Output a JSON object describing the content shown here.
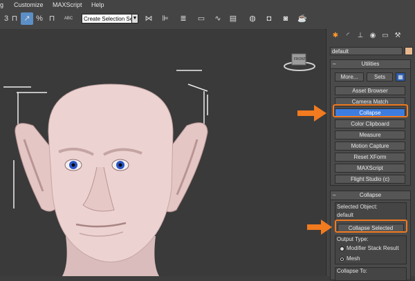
{
  "menubar": {
    "items": [
      "g",
      "Customize",
      "MAXScript",
      "Help"
    ]
  },
  "toolbar": {
    "selection_set": "Create Selection Se",
    "numbers": [
      "3",
      "%"
    ],
    "text_abc": "ABC"
  },
  "viewport": {
    "viewcube_label": "FRONT"
  },
  "command_panel": {
    "object_name": "default",
    "accent_color": "#e8b88f",
    "utilities": {
      "title": "Utilities",
      "more_label": "More...",
      "sets_label": "Sets",
      "buttons": [
        "Asset Browser",
        "Camera Match",
        "Collapse",
        "Color Clipboard",
        "Measure",
        "Motion Capture",
        "Reset XForm",
        "MAXScript",
        "Flight Studio (c)"
      ]
    },
    "collapse": {
      "title": "Collapse",
      "selected_label": "Selected Object:",
      "selected_value": "default",
      "collapse_selected_label": "Collapse Selected",
      "output_type_label": "Output Type:",
      "option_modifier": "Modifier Stack Result",
      "option_mesh": "Mesh",
      "collapse_to_label": "Collapse To:"
    }
  },
  "colors": {
    "highlight": "#3d7de0",
    "callout": "#f27a1f"
  }
}
